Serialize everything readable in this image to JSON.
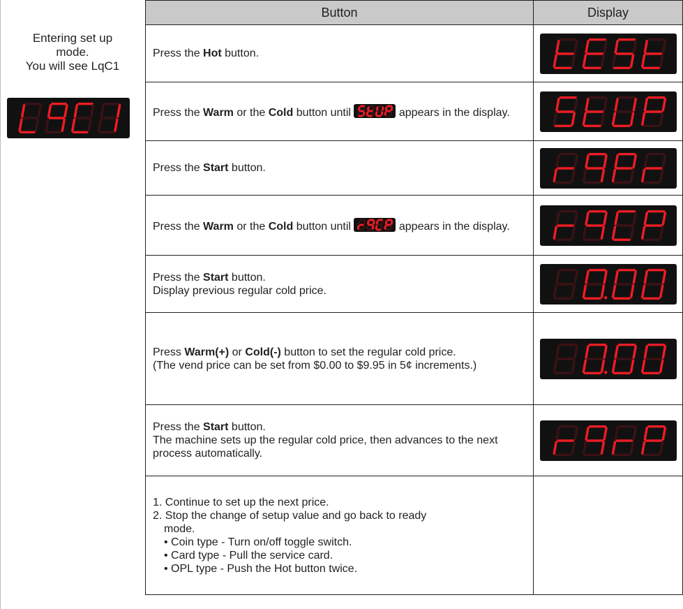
{
  "left": {
    "title_lines": [
      "Entering set up",
      "mode.",
      "You will see LqC1"
    ],
    "display_code": "LqC1"
  },
  "headers": {
    "button": "Button",
    "display": "Display"
  },
  "rows": [
    {
      "parts": [
        {
          "t": "Press the "
        },
        {
          "t": "Hot",
          "b": true
        },
        {
          "t": " button."
        }
      ],
      "display_code": "tESt"
    },
    {
      "parts": [
        {
          "t": "Press the "
        },
        {
          "t": "Warm",
          "b": true
        },
        {
          "t": " or the "
        },
        {
          "t": "Cold",
          "b": true
        },
        {
          "t": " button until "
        },
        {
          "seg": "StUP"
        },
        {
          "t": " appears in the display."
        }
      ],
      "display_code": "StUP"
    },
    {
      "parts": [
        {
          "t": "Press the "
        },
        {
          "t": "Start",
          "b": true
        },
        {
          "t": " button."
        }
      ],
      "display_code": "rqPr"
    },
    {
      "parts": [
        {
          "t": "Press the "
        },
        {
          "t": "Warm",
          "b": true
        },
        {
          "t": " or the "
        },
        {
          "t": "Cold",
          "b": true
        },
        {
          "t": " button until "
        },
        {
          "seg": "rqCP"
        },
        {
          "t": " appears in the display."
        }
      ],
      "display_code": "rqCP"
    },
    {
      "parts": [
        {
          "t": "Press the "
        },
        {
          "t": "Start",
          "b": true
        },
        {
          "t": " button."
        },
        {
          "br": true
        },
        {
          "t": "Display previous regular cold price."
        }
      ],
      "display_code": "0.00"
    },
    {
      "parts": [
        {
          "t": "Press "
        },
        {
          "t": "Warm(+)",
          "b": true
        },
        {
          "t": " or "
        },
        {
          "t": "Cold(-)",
          "b": true
        },
        {
          "t": " button to set the regular cold price."
        },
        {
          "br": true
        },
        {
          "t": "(The vend price can be set from $0.00 to $9.95 in 5¢ increments.)"
        }
      ],
      "display_code": "0.00"
    },
    {
      "parts": [
        {
          "t": "Press the "
        },
        {
          "t": "Start",
          "b": true
        },
        {
          "t": " button."
        },
        {
          "br": true
        },
        {
          "t": "The machine sets up the regular cold price, then advances to the next process automatically."
        }
      ],
      "display_code": "rqrP"
    },
    {
      "lines": [
        {
          "t": "1. Continue to set up the next price."
        },
        {
          "t": "2. Stop the change of setup value and go back to ready"
        },
        {
          "t": "mode.",
          "indent": true
        },
        {
          "t": "• Coin type - Turn on/off toggle switch.",
          "bullet": true
        },
        {
          "t": "• Card type - Pull the service card.",
          "bullet": true
        },
        {
          "t": "• OPL type - Push the Hot button twice.",
          "bullet": true
        }
      ],
      "display_code": ""
    }
  ],
  "colors": {
    "header_bg": "#c9c9c9",
    "display_bg": "#111111",
    "segment_on": "#ec1c24",
    "segment_off": "#3a1214",
    "border": "#231f20"
  }
}
